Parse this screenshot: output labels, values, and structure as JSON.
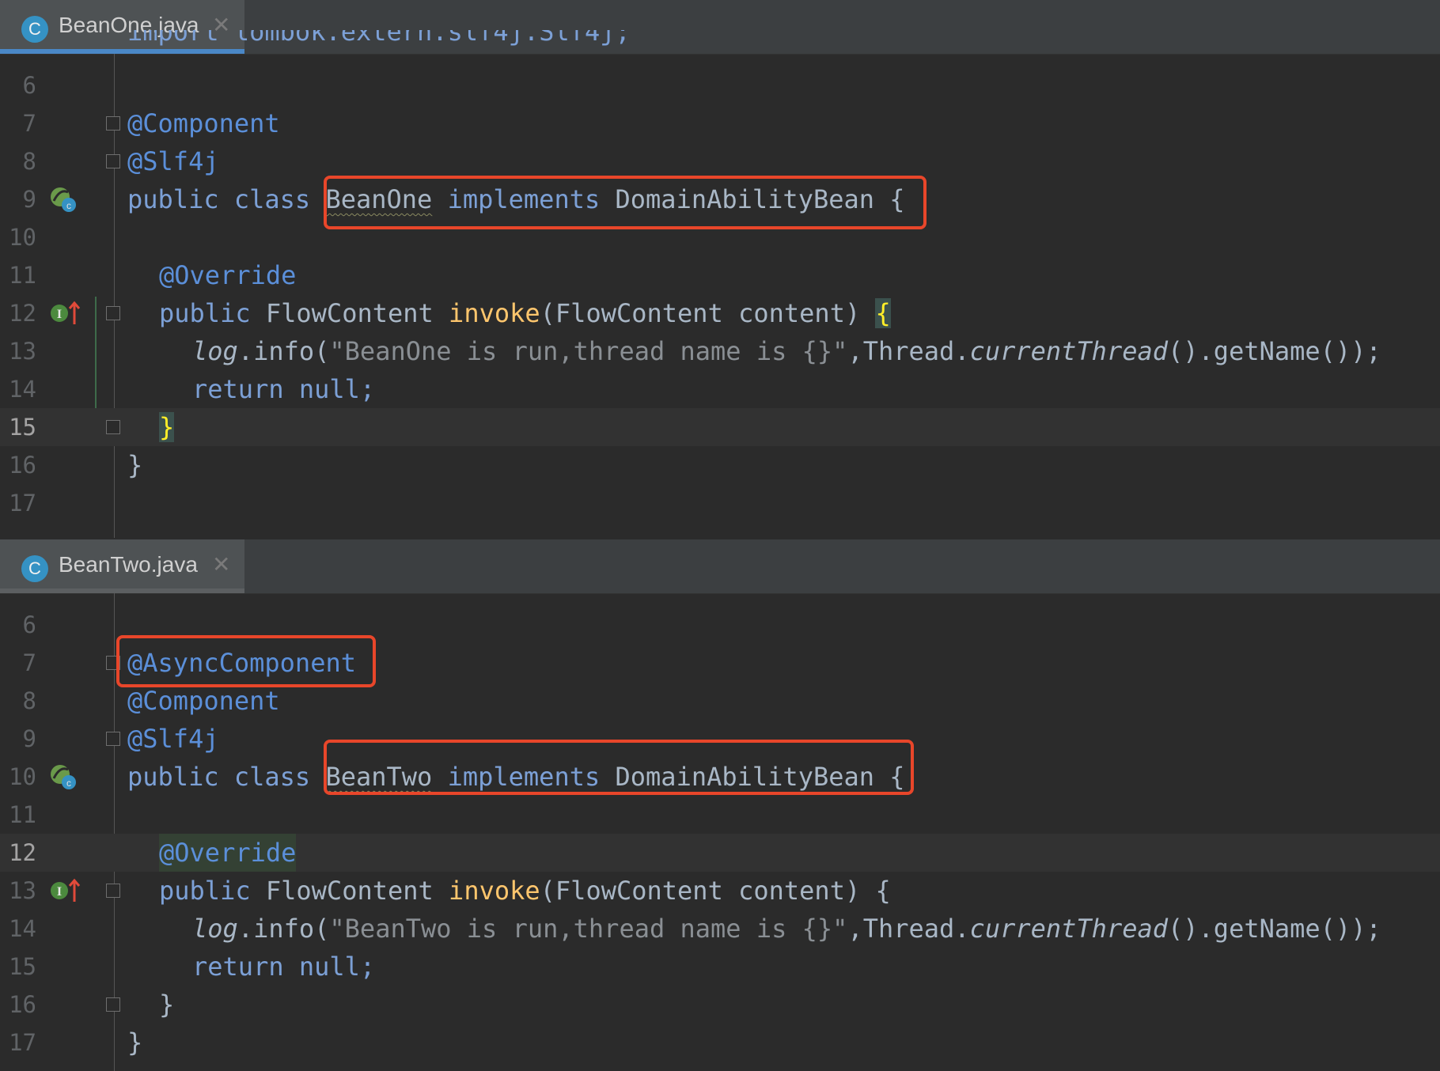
{
  "pane1": {
    "tab": {
      "icon_letter": "C",
      "name": "BeanOne.java",
      "close": "✕"
    },
    "lines": [
      {
        "no": "6"
      },
      {
        "no": "7",
        "annotation": "@Component"
      },
      {
        "no": "8",
        "annotation": "@Slf4j"
      },
      {
        "no": "9",
        "kw": "public class ",
        "class_name": "BeanOne",
        "kw2": " implements ",
        "iface": "DomainAbilityBean",
        "brace": " {"
      },
      {
        "no": "10"
      },
      {
        "no": "11",
        "annotation": "@Override"
      },
      {
        "no": "12",
        "kw": "public ",
        "type": "FlowContent ",
        "method": "invoke",
        "params": "(FlowContent content) ",
        "brace": "{"
      },
      {
        "no": "13",
        "log": "log",
        "call": ".info(",
        "string": "\"BeanOne is run,thread name is {}\"",
        "rest1": ",Thread.",
        "italic": "currentThread",
        "rest2": "().getName());"
      },
      {
        "no": "14",
        "ret": "return null;"
      },
      {
        "no": "15",
        "brace": "}"
      },
      {
        "no": "16",
        "brace": "}"
      },
      {
        "no": "17"
      }
    ]
  },
  "pane2": {
    "tab": {
      "icon_letter": "C",
      "name": "BeanTwo.java",
      "close": "✕"
    },
    "lines": [
      {
        "no": "6"
      },
      {
        "no": "7",
        "annotation": "@AsyncComponent"
      },
      {
        "no": "8",
        "annotation": "@Component"
      },
      {
        "no": "9",
        "annotation": "@Slf4j"
      },
      {
        "no": "10",
        "kw": "public class ",
        "class_name": "BeanTwo",
        "kw2": " implements ",
        "iface": "DomainAbilityBean",
        "brace": " {"
      },
      {
        "no": "11"
      },
      {
        "no": "12",
        "annotation": "@Override"
      },
      {
        "no": "13",
        "kw": "public ",
        "type": "FlowContent ",
        "method": "invoke",
        "params": "(FlowContent content) ",
        "brace": "{"
      },
      {
        "no": "14",
        "log": "log",
        "call": ".info(",
        "string": "\"BeanTwo is run,thread name is {}\"",
        "rest1": ",Thread.",
        "italic": "currentThread",
        "rest2": "().getName());"
      },
      {
        "no": "15",
        "ret": "return null;"
      },
      {
        "no": "16",
        "brace": "}"
      },
      {
        "no": "17",
        "brace": "}"
      }
    ]
  },
  "colors": {
    "highlight_box": "#e8462a",
    "background": "#2b2b2b",
    "keyword": "#7ca0d6",
    "method": "#ffc66d"
  }
}
